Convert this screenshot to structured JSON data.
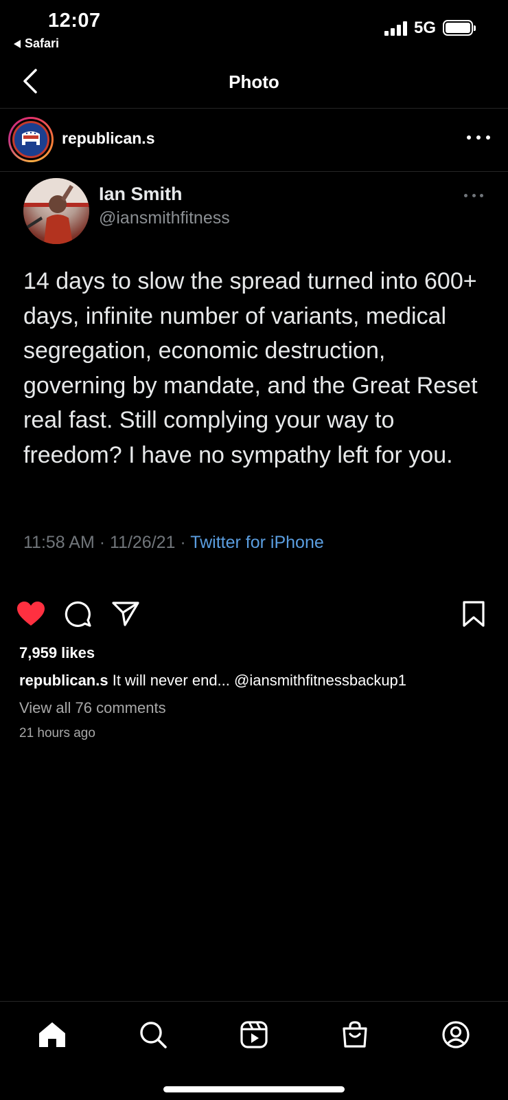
{
  "status_bar": {
    "time": "12:07",
    "back_app": "Safari",
    "network": "5G"
  },
  "header": {
    "title": "Photo"
  },
  "post": {
    "author": "republican.s",
    "tweet": {
      "name": "Ian Smith",
      "handle": "@iansmithfitness",
      "text": "14 days to slow the spread turned into 600+ days, infinite number of variants, medical segregation, economic destruction, governing by mandate, and the Great Reset real fast. Still complying your way to freedom? I have no sympathy left for you.",
      "meta_time": "11:58 AM · 11/26/21 · ",
      "meta_source": "Twitter for iPhone"
    },
    "likes": "7,959 likes",
    "caption_user": "republican.s",
    "caption_text": " It will never end... @iansmithfitnessbackup1",
    "view_comments": "View all 76 comments",
    "time_ago": "21 hours ago",
    "liked": true
  },
  "icons": {
    "like": "heart-icon",
    "comment": "comment-icon",
    "share": "send-icon",
    "save": "bookmark-icon"
  },
  "nav": [
    "home-icon",
    "search-icon",
    "reels-icon",
    "shop-icon",
    "profile-icon"
  ],
  "colors": {
    "like_red": "#ff3040",
    "link_blue": "#5b9ee0",
    "background": "#000000"
  }
}
